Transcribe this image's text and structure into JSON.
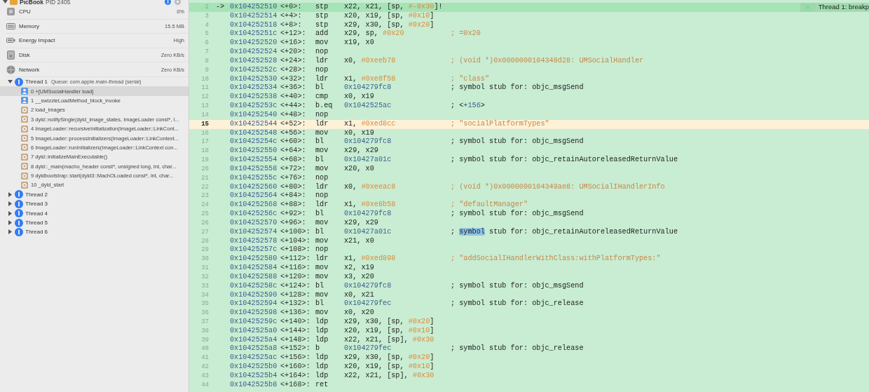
{
  "sidebar": {
    "process": {
      "name": "PicBook",
      "pid": "PID 2405",
      "expanded": true
    },
    "gauges": [
      {
        "kind": "cpu",
        "label": "CPU",
        "value": "0%"
      },
      {
        "kind": "memory",
        "label": "Memory",
        "value": "15.5 MB"
      },
      {
        "kind": "energy",
        "label": "Energy Impact",
        "value": "High"
      },
      {
        "kind": "disk",
        "label": "Disk",
        "value": "Zero KB/s"
      },
      {
        "kind": "network",
        "label": "Network",
        "value": "Zero KB/s"
      }
    ],
    "threads": [
      {
        "label": "Thread 1",
        "queue": "Queue: com.apple.main-thread (serial)",
        "expanded": true,
        "frames": [
          {
            "kind": "user",
            "text": "0 +[UMSocialHandler load]",
            "selected": true
          },
          {
            "kind": "user",
            "text": "1 __swizzleLoadMethod_block_invoke",
            "selected": false
          },
          {
            "kind": "system",
            "text": "2 load_images",
            "selected": false
          },
          {
            "kind": "system",
            "text": "3 dyld::notifySingle(dyld_image_states, ImageLoader const*, I...",
            "selected": false
          },
          {
            "kind": "system",
            "text": "4 ImageLoader::recursiveInitialization(ImageLoader::LinkCont...",
            "selected": false
          },
          {
            "kind": "system",
            "text": "5 ImageLoader::processInitializers(ImageLoader::LinkContext...",
            "selected": false
          },
          {
            "kind": "system",
            "text": "6 ImageLoader::runInitializers(ImageLoader::LinkContext con...",
            "selected": false
          },
          {
            "kind": "system",
            "text": "7 dyld::initializeMainExecutable()",
            "selected": false
          },
          {
            "kind": "system",
            "text": "8 dyld::_main(macho_header const*, unsigned long, int, char...",
            "selected": false
          },
          {
            "kind": "system",
            "text": "9 dyldbootstrap::start(dyld3::MachOLoaded const*, int, char...",
            "selected": false
          },
          {
            "kind": "system",
            "text": "10 _dyld_start",
            "selected": false
          }
        ]
      },
      {
        "label": "Thread 2",
        "expanded": false
      },
      {
        "label": "Thread 3",
        "expanded": false
      },
      {
        "label": "Thread 4",
        "expanded": false
      },
      {
        "label": "Thread 5",
        "expanded": false
      },
      {
        "label": "Thread 6",
        "expanded": false
      }
    ]
  },
  "disassembly": {
    "lines": [
      {
        "num": "2",
        "current": true,
        "highlighted": false,
        "arrow": "->",
        "addr": "0x104252510",
        "offset": "<+0>:",
        "op": "stp",
        "args": [
          {
            "t": "x22, x21, [sp, "
          },
          {
            "t": "#-0x30",
            "kind": "imm"
          },
          {
            "t": "]!"
          }
        ],
        "badge": {
          "icon": "=",
          "text": "Thread 1: breakp"
        }
      },
      {
        "num": "3",
        "current": false,
        "highlighted": false,
        "addr": "0x104252514",
        "offset": "<+4>:",
        "op": "stp",
        "args": [
          {
            "t": "x20, x19, [sp, "
          },
          {
            "t": "#0x10",
            "kind": "imm"
          },
          {
            "t": "]"
          }
        ]
      },
      {
        "num": "4",
        "current": false,
        "highlighted": false,
        "addr": "0x104252518",
        "offset": "<+8>:",
        "op": "stp",
        "args": [
          {
            "t": "x29, x30, [sp, "
          },
          {
            "t": "#0x20",
            "kind": "imm"
          },
          {
            "t": "]"
          }
        ]
      },
      {
        "num": "5",
        "current": false,
        "highlighted": false,
        "addr": "0x10425251c",
        "offset": "<+12>:",
        "op": "add",
        "args": [
          {
            "t": "x29, sp, "
          },
          {
            "t": "#0x20",
            "kind": "imm"
          }
        ],
        "comment": [
          {
            "t": "; =0x20",
            "kind": "str"
          }
        ]
      },
      {
        "num": "6",
        "current": false,
        "highlighted": false,
        "addr": "0x104252520",
        "offset": "<+16>:",
        "op": "mov",
        "args": [
          {
            "t": "x19, x0"
          }
        ]
      },
      {
        "num": "7",
        "current": false,
        "highlighted": false,
        "addr": "0x104252524",
        "offset": "<+20>:",
        "op": "nop"
      },
      {
        "num": "8",
        "current": false,
        "highlighted": false,
        "addr": "0x104252528",
        "offset": "<+24>:",
        "op": "ldr",
        "args": [
          {
            "t": "x0, "
          },
          {
            "t": "#0xeeb78",
            "kind": "imm"
          }
        ],
        "comment": [
          {
            "t": "; (void *)0x0000000104348d28: UMSocialHandler",
            "kind": "str"
          }
        ]
      },
      {
        "num": "9",
        "current": false,
        "highlighted": false,
        "addr": "0x10425252c",
        "offset": "<+28>:",
        "op": "nop"
      },
      {
        "num": "10",
        "current": false,
        "highlighted": false,
        "addr": "0x104252530",
        "offset": "<+32>:",
        "op": "ldr",
        "args": [
          {
            "t": "x1, "
          },
          {
            "t": "#0xe8f58",
            "kind": "imm"
          }
        ],
        "comment": [
          {
            "t": "; \"class\"",
            "kind": "str"
          }
        ]
      },
      {
        "num": "11",
        "current": false,
        "highlighted": false,
        "addr": "0x104252534",
        "offset": "<+36>:",
        "op": "bl",
        "args": [
          {
            "t": "0x104279fc8",
            "kind": "addr"
          }
        ],
        "comment": [
          {
            "t": "; symbol stub for: objc_msgSend"
          }
        ]
      },
      {
        "num": "12",
        "current": false,
        "highlighted": false,
        "addr": "0x104252538",
        "offset": "<+40>:",
        "op": "cmp",
        "args": [
          {
            "t": "x0, x19"
          }
        ]
      },
      {
        "num": "13",
        "current": false,
        "highlighted": false,
        "addr": "0x10425253c",
        "offset": "<+44>:",
        "op": "b.eq",
        "args": [
          {
            "t": "0x1042525ac",
            "kind": "addr"
          }
        ],
        "comment": [
          {
            "t": "; <"
          },
          {
            "t": "+156",
            "kind": "addr"
          },
          {
            "t": ">"
          }
        ]
      },
      {
        "num": "14",
        "current": false,
        "highlighted": false,
        "addr": "0x104252540",
        "offset": "<+48>:",
        "op": "nop"
      },
      {
        "num": "15",
        "current": false,
        "highlighted": true,
        "addr": "0x104252544",
        "offset": "<+52>:",
        "op": "ldr",
        "args": [
          {
            "t": "x1, "
          },
          {
            "t": "#0xed8cc",
            "kind": "imm"
          }
        ],
        "comment": [
          {
            "t": "; \"socialPlatformTypes\"",
            "kind": "str"
          }
        ]
      },
      {
        "num": "16",
        "current": false,
        "highlighted": false,
        "addr": "0x104252548",
        "offset": "<+56>:",
        "op": "mov",
        "args": [
          {
            "t": "x0, x19"
          }
        ]
      },
      {
        "num": "17",
        "current": false,
        "highlighted": false,
        "addr": "0x10425254c",
        "offset": "<+60>:",
        "op": "bl",
        "args": [
          {
            "t": "0x104279fc8",
            "kind": "addr"
          }
        ],
        "comment": [
          {
            "t": "; symbol stub for: objc_msgSend"
          }
        ]
      },
      {
        "num": "18",
        "current": false,
        "highlighted": false,
        "addr": "0x104252550",
        "offset": "<+64>:",
        "op": "mov",
        "args": [
          {
            "t": "x29, x29"
          }
        ]
      },
      {
        "num": "19",
        "current": false,
        "highlighted": false,
        "addr": "0x104252554",
        "offset": "<+68>:",
        "op": "bl",
        "args": [
          {
            "t": "0x10427a01c",
            "kind": "addr"
          }
        ],
        "comment": [
          {
            "t": "; symbol stub for: objc_retainAutoreleasedReturnValue"
          }
        ]
      },
      {
        "num": "20",
        "current": false,
        "highlighted": false,
        "addr": "0x104252558",
        "offset": "<+72>:",
        "op": "mov",
        "args": [
          {
            "t": "x20, x0"
          }
        ]
      },
      {
        "num": "21",
        "current": false,
        "highlighted": false,
        "addr": "0x10425255c",
        "offset": "<+76>:",
        "op": "nop"
      },
      {
        "num": "22",
        "current": false,
        "highlighted": false,
        "addr": "0x104252560",
        "offset": "<+80>:",
        "op": "ldr",
        "args": [
          {
            "t": "x0, "
          },
          {
            "t": "#0xeeac8",
            "kind": "imm"
          }
        ],
        "comment": [
          {
            "t": "; (void *)0x0000000104349ae8: UMSocialIHandlerInfo",
            "kind": "str"
          }
        ]
      },
      {
        "num": "23",
        "current": false,
        "highlighted": false,
        "addr": "0x104252564",
        "offset": "<+84>:",
        "op": "nop"
      },
      {
        "num": "24",
        "current": false,
        "highlighted": false,
        "addr": "0x104252568",
        "offset": "<+88>:",
        "op": "ldr",
        "args": [
          {
            "t": "x1, "
          },
          {
            "t": "#0xe8b58",
            "kind": "imm"
          }
        ],
        "comment": [
          {
            "t": "; \"defaultManager\"",
            "kind": "str"
          }
        ]
      },
      {
        "num": "25",
        "current": false,
        "highlighted": false,
        "addr": "0x10425256c",
        "offset": "<+92>:",
        "op": "bl",
        "args": [
          {
            "t": "0x104279fc8",
            "kind": "addr"
          }
        ],
        "comment": [
          {
            "t": "; symbol stub for: objc_msgSend"
          }
        ]
      },
      {
        "num": "26",
        "current": false,
        "highlighted": false,
        "addr": "0x104252570",
        "offset": "<+96>:",
        "op": "mov",
        "args": [
          {
            "t": "x29, x29"
          }
        ]
      },
      {
        "num": "27",
        "current": false,
        "highlighted": false,
        "addr": "0x104252574",
        "offset": "<+100>:",
        "op": "bl",
        "args": [
          {
            "t": "0x10427a01c",
            "kind": "addr"
          }
        ],
        "comment": [
          {
            "t": "; "
          },
          {
            "t": "symbol",
            "kind": "found"
          },
          {
            "t": " stub for: objc_retainAutoreleasedReturnValue"
          }
        ]
      },
      {
        "num": "28",
        "current": false,
        "highlighted": false,
        "addr": "0x104252578",
        "offset": "<+104>:",
        "op": "mov",
        "args": [
          {
            "t": "x21, x0"
          }
        ]
      },
      {
        "num": "29",
        "current": false,
        "highlighted": false,
        "addr": "0x10425257c",
        "offset": "<+108>:",
        "op": "nop"
      },
      {
        "num": "30",
        "current": false,
        "highlighted": false,
        "addr": "0x104252580",
        "offset": "<+112>:",
        "op": "ldr",
        "args": [
          {
            "t": "x1, "
          },
          {
            "t": "#0xed898",
            "kind": "imm"
          }
        ],
        "comment": [
          {
            "t": "; \"addSocialIHandlerWithClass:withPlatformTypes:\"",
            "kind": "str"
          }
        ]
      },
      {
        "num": "31",
        "current": false,
        "highlighted": false,
        "addr": "0x104252584",
        "offset": "<+116>:",
        "op": "mov",
        "args": [
          {
            "t": "x2, x19"
          }
        ]
      },
      {
        "num": "32",
        "current": false,
        "highlighted": false,
        "addr": "0x104252588",
        "offset": "<+120>:",
        "op": "mov",
        "args": [
          {
            "t": "x3, x20"
          }
        ]
      },
      {
        "num": "33",
        "current": false,
        "highlighted": false,
        "addr": "0x10425258c",
        "offset": "<+124>:",
        "op": "bl",
        "args": [
          {
            "t": "0x104279fc8",
            "kind": "addr"
          }
        ],
        "comment": [
          {
            "t": "; symbol stub for: objc_msgSend"
          }
        ]
      },
      {
        "num": "34",
        "current": false,
        "highlighted": false,
        "addr": "0x104252590",
        "offset": "<+128>:",
        "op": "mov",
        "args": [
          {
            "t": "x0, x21"
          }
        ]
      },
      {
        "num": "35",
        "current": false,
        "highlighted": false,
        "addr": "0x104252594",
        "offset": "<+132>:",
        "op": "bl",
        "args": [
          {
            "t": "0x104279fec",
            "kind": "addr"
          }
        ],
        "comment": [
          {
            "t": "; symbol stub for: objc_release"
          }
        ]
      },
      {
        "num": "36",
        "current": false,
        "highlighted": false,
        "addr": "0x104252598",
        "offset": "<+136>:",
        "op": "mov",
        "args": [
          {
            "t": "x0, x20"
          }
        ]
      },
      {
        "num": "37",
        "current": false,
        "highlighted": false,
        "addr": "0x10425259c",
        "offset": "<+140>:",
        "op": "ldp",
        "args": [
          {
            "t": "x29, x30, [sp, "
          },
          {
            "t": "#0x20",
            "kind": "imm"
          },
          {
            "t": "]"
          }
        ]
      },
      {
        "num": "38",
        "current": false,
        "highlighted": false,
        "addr": "0x1042525a0",
        "offset": "<+144>:",
        "op": "ldp",
        "args": [
          {
            "t": "x20, x19, [sp, "
          },
          {
            "t": "#0x10",
            "kind": "imm"
          },
          {
            "t": "]"
          }
        ]
      },
      {
        "num": "39",
        "current": false,
        "highlighted": false,
        "addr": "0x1042525a4",
        "offset": "<+148>:",
        "op": "ldp",
        "args": [
          {
            "t": "x22, x21, [sp], "
          },
          {
            "t": "#0x30",
            "kind": "imm"
          }
        ]
      },
      {
        "num": "40",
        "current": false,
        "highlighted": false,
        "addr": "0x1042525a8",
        "offset": "<+152>:",
        "op": "b",
        "args": [
          {
            "t": "0x104279fec",
            "kind": "addr"
          }
        ],
        "comment": [
          {
            "t": "; symbol stub for: objc_release"
          }
        ]
      },
      {
        "num": "41",
        "current": false,
        "highlighted": false,
        "addr": "0x1042525ac",
        "offset": "<+156>:",
        "op": "ldp",
        "args": [
          {
            "t": "x29, x30, [sp, "
          },
          {
            "t": "#0x20",
            "kind": "imm"
          },
          {
            "t": "]"
          }
        ]
      },
      {
        "num": "42",
        "current": false,
        "highlighted": false,
        "addr": "0x1042525b0",
        "offset": "<+160>:",
        "op": "ldp",
        "args": [
          {
            "t": "x20, x19, [sp, "
          },
          {
            "t": "#0x10",
            "kind": "imm"
          },
          {
            "t": "]"
          }
        ]
      },
      {
        "num": "43",
        "current": false,
        "highlighted": false,
        "addr": "0x1042525b4",
        "offset": "<+164>:",
        "op": "ldp",
        "args": [
          {
            "t": "x22, x21, [sp], "
          },
          {
            "t": "#0x30",
            "kind": "imm"
          }
        ]
      },
      {
        "num": "44",
        "current": false,
        "highlighted": false,
        "addr": "0x1042525b8",
        "offset": "<+168>:",
        "op": "ret"
      }
    ]
  }
}
